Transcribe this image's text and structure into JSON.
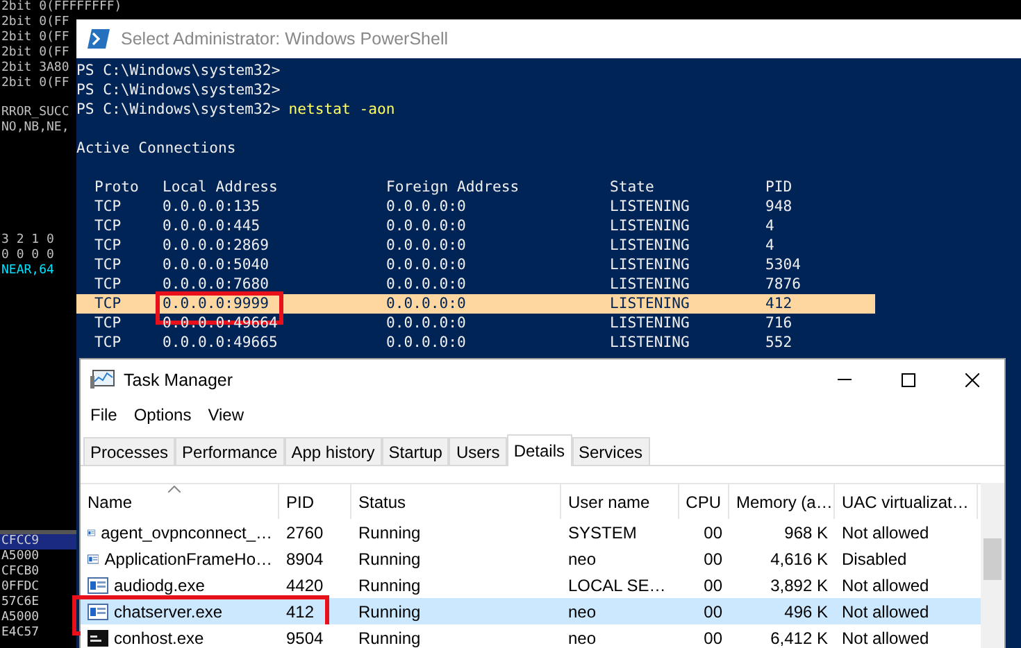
{
  "debugger": {
    "top_lines": [
      "2bit 0(FFFFFFFF)",
      "2bit 0(FF",
      "2bit 0(FF",
      "2bit 0(FF",
      "2bit 3A80",
      "2bit 0(FF"
    ],
    "status_lines": [
      "RROR_SUCC",
      "NO,NB,NE,"
    ],
    "flag_lines": [
      {
        "text": "3 2 1 0",
        "kind": "plain"
      },
      {
        "text": "0 0 0 0",
        "kind": "plain"
      },
      {
        "text": "NEAR,64",
        "kind": "accent"
      }
    ],
    "dump_rows": [
      {
        "address": "CFCC9",
        "selected": true
      },
      {
        "address": "A5000",
        "selected": false
      },
      {
        "address": "CFCB0",
        "selected": false
      },
      {
        "address": "0FFDC",
        "selected": false
      },
      {
        "address": "57C6E",
        "selected": false
      },
      {
        "address": "A5000",
        "selected": false
      },
      {
        "address": "E4C57",
        "selected": false
      }
    ]
  },
  "powershell": {
    "title": "Select Administrator: Windows PowerShell",
    "prompts": [
      {
        "prompt": "PS C:\\Windows\\system32>"
      },
      {
        "prompt": "PS C:\\Windows\\system32>"
      },
      {
        "prompt": "PS C:\\Windows\\system32>",
        "command": "netstat -aon"
      }
    ],
    "heading": "Active Connections",
    "columns": [
      "Proto",
      "Local Address",
      "Foreign Address",
      "State",
      "PID"
    ],
    "rows": [
      {
        "cells": [
          "TCP",
          "0.0.0.0:135",
          "0.0.0.0:0",
          "LISTENING",
          "948"
        ],
        "selected": false,
        "boxed": false
      },
      {
        "cells": [
          "TCP",
          "0.0.0.0:445",
          "0.0.0.0:0",
          "LISTENING",
          "4"
        ],
        "selected": false,
        "boxed": false
      },
      {
        "cells": [
          "TCP",
          "0.0.0.0:2869",
          "0.0.0.0:0",
          "LISTENING",
          "4"
        ],
        "selected": false,
        "boxed": false
      },
      {
        "cells": [
          "TCP",
          "0.0.0.0:5040",
          "0.0.0.0:0",
          "LISTENING",
          "5304"
        ],
        "selected": false,
        "boxed": false
      },
      {
        "cells": [
          "TCP",
          "0.0.0.0:7680",
          "0.0.0.0:0",
          "LISTENING",
          "7876"
        ],
        "selected": false,
        "boxed": false
      },
      {
        "cells": [
          "TCP",
          "0.0.0.0:9999",
          "0.0.0.0:0",
          "LISTENING",
          "412"
        ],
        "selected": true,
        "boxed": true
      },
      {
        "cells": [
          "TCP",
          "0.0.0.0:49664",
          "0.0.0.0:0",
          "LISTENING",
          "716"
        ],
        "selected": false,
        "boxed": false
      },
      {
        "cells": [
          "TCP",
          "0.0.0.0:49665",
          "0.0.0.0:0",
          "LISTENING",
          "552"
        ],
        "selected": false,
        "boxed": false
      }
    ]
  },
  "task_manager": {
    "title": "Task Manager",
    "menu": [
      "File",
      "Options",
      "View"
    ],
    "tabs": [
      {
        "label": "Processes",
        "selected": false
      },
      {
        "label": "Performance",
        "selected": false
      },
      {
        "label": "App history",
        "selected": false
      },
      {
        "label": "Startup",
        "selected": false
      },
      {
        "label": "Users",
        "selected": false
      },
      {
        "label": "Details",
        "selected": true
      },
      {
        "label": "Services",
        "selected": false
      }
    ],
    "columns": [
      "Name",
      "PID",
      "Status",
      "User name",
      "CPU",
      "Memory (a…",
      "UAC virtualizat…"
    ],
    "rows": [
      {
        "kind": "window",
        "cells": [
          "agent_ovpnconnect_…",
          "2760",
          "Running",
          "SYSTEM",
          "00",
          "968 K",
          "Not allowed"
        ],
        "selected": false,
        "boxed": false
      },
      {
        "kind": "window",
        "cells": [
          "ApplicationFrameHo…",
          "8904",
          "Running",
          "neo",
          "00",
          "4,616 K",
          "Disabled"
        ],
        "selected": false,
        "boxed": false
      },
      {
        "kind": "window",
        "cells": [
          "audiodg.exe",
          "4420",
          "Running",
          "LOCAL SE…",
          "00",
          "3,892 K",
          "Not allowed"
        ],
        "selected": false,
        "boxed": false
      },
      {
        "kind": "window",
        "cells": [
          "chatserver.exe",
          "412",
          "Running",
          "neo",
          "00",
          "496 K",
          "Not allowed"
        ],
        "selected": true,
        "boxed": true
      },
      {
        "kind": "console",
        "cells": [
          "conhost.exe",
          "9504",
          "Running",
          "neo",
          "00",
          "6,412 K",
          "Not allowed"
        ],
        "selected": false,
        "boxed": false
      }
    ]
  }
}
